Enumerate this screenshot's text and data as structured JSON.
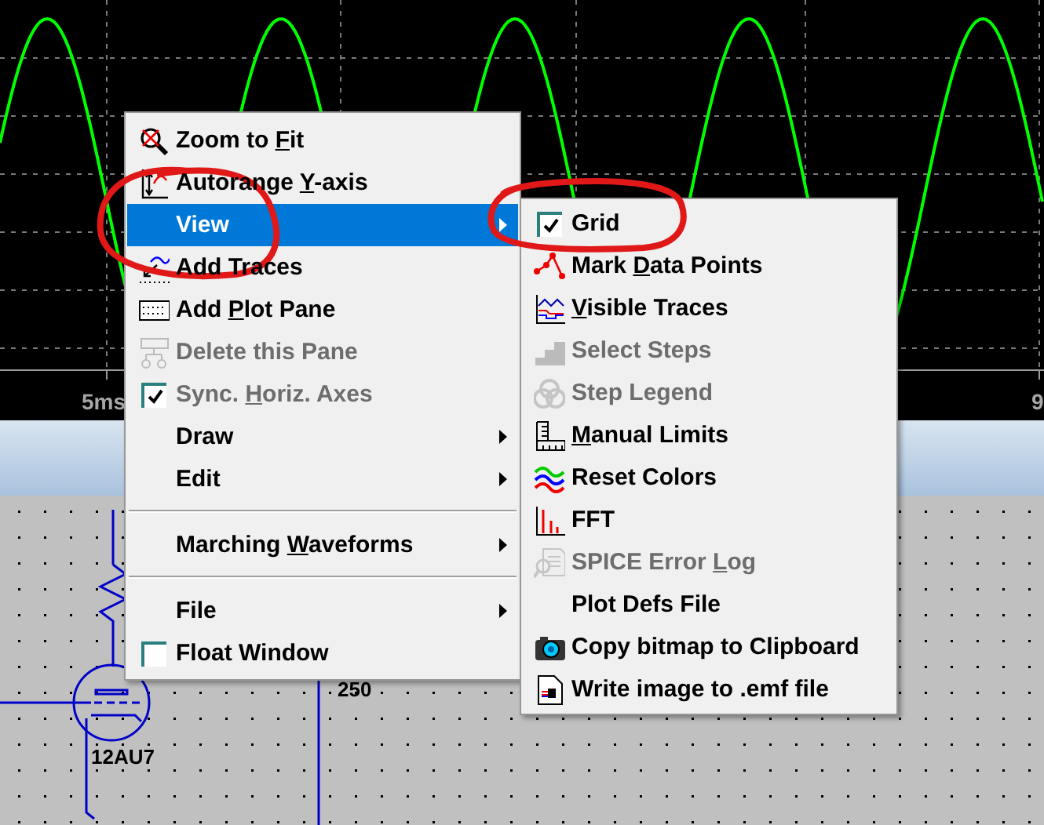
{
  "plot": {
    "x_tick_labels": [
      "5ms",
      "9"
    ]
  },
  "schematic": {
    "labels": [
      "250",
      "12AU7"
    ]
  },
  "context_menu": {
    "items": [
      {
        "kind": "command",
        "label": [
          "Zoom to ",
          "F",
          "it"
        ],
        "selected": false,
        "disabled": false
      },
      {
        "kind": "command",
        "label": [
          "Autorange ",
          "Y",
          "-axis"
        ],
        "selected": false,
        "disabled": false
      },
      {
        "kind": "submenu",
        "label": [
          "View"
        ],
        "selected": true,
        "disabled": false
      },
      {
        "kind": "command",
        "label": [
          "Add Traces"
        ],
        "selected": false,
        "disabled": false
      },
      {
        "kind": "command",
        "label": [
          "Add ",
          "P",
          "lot Pane"
        ],
        "selected": false,
        "disabled": false
      },
      {
        "kind": "command",
        "label": [
          "Delete this Pane"
        ],
        "selected": false,
        "disabled": true
      },
      {
        "kind": "check",
        "label": [
          "Sync. ",
          "H",
          "oriz. Axes"
        ],
        "selected": false,
        "disabled": true,
        "checked": true
      },
      {
        "kind": "submenu",
        "label": [
          "Draw"
        ],
        "selected": false,
        "disabled": false
      },
      {
        "kind": "submenu",
        "label": [
          "Edit"
        ],
        "selected": false,
        "disabled": false
      },
      {
        "kind": "separator"
      },
      {
        "kind": "submenu",
        "label": [
          "Marching ",
          "W",
          "aveforms"
        ],
        "selected": false,
        "disabled": false
      },
      {
        "kind": "separator"
      },
      {
        "kind": "submenu",
        "label": [
          "File"
        ],
        "selected": false,
        "disabled": false
      },
      {
        "kind": "check",
        "label": [
          "Float Window"
        ],
        "selected": false,
        "disabled": false,
        "checked": false
      }
    ]
  },
  "view_submenu": {
    "items": [
      {
        "kind": "check",
        "label": [
          "Grid"
        ],
        "selected": false,
        "disabled": false,
        "checked": true
      },
      {
        "kind": "command",
        "label": [
          "Mark ",
          "D",
          "ata Points"
        ],
        "selected": false,
        "disabled": false
      },
      {
        "kind": "command",
        "label": [
          "V",
          "isible Traces"
        ],
        "selected": false,
        "disabled": false,
        "key_first": true
      },
      {
        "kind": "command",
        "label": [
          "Select Steps"
        ],
        "selected": false,
        "disabled": true
      },
      {
        "kind": "command",
        "label": [
          "Step Legend"
        ],
        "selected": false,
        "disabled": true
      },
      {
        "kind": "command",
        "label": [
          "M",
          "anual Limits"
        ],
        "selected": false,
        "disabled": false,
        "key_first": true
      },
      {
        "kind": "command",
        "label": [
          "Reset Colors"
        ],
        "selected": false,
        "disabled": false
      },
      {
        "kind": "command",
        "label": [
          "FFT"
        ],
        "selected": false,
        "disabled": false
      },
      {
        "kind": "command",
        "label": [
          "SPICE Error ",
          "L",
          "og"
        ],
        "selected": false,
        "disabled": true
      },
      {
        "kind": "command",
        "label": [
          "Plot Defs File"
        ],
        "selected": false,
        "disabled": false
      },
      {
        "kind": "command",
        "label": [
          "Copy bitmap to Clipboard"
        ],
        "selected": false,
        "disabled": false
      },
      {
        "kind": "command",
        "label": [
          "Write image to .emf file"
        ],
        "selected": false,
        "disabled": false
      }
    ]
  }
}
